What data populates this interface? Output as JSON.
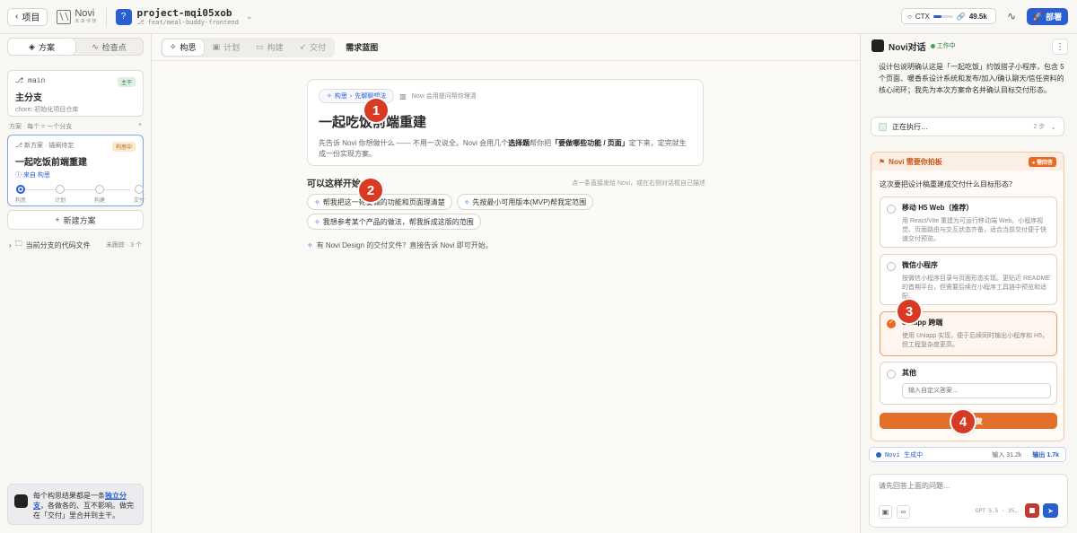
{
  "topbar": {
    "back_label": "项目",
    "logo_text": "Novi",
    "logo_sub": "未 来 伴 随",
    "project_name": "project-mqi05xob",
    "project_branch": "feat/meal-buddy-frontend",
    "ctx_label": "CTX",
    "ctx_fraction": 0.4,
    "token_count": "49.5k",
    "deploy_label": "部署"
  },
  "sidebar": {
    "tabs": [
      {
        "label": "方案",
        "active": true
      },
      {
        "label": "检查点",
        "active": false
      }
    ],
    "main_branch": {
      "branch": "main",
      "tag": "主干",
      "title": "主分支",
      "desc": "chore: 初始化项目仓库"
    },
    "plans_header": "方案 · 每个 = 一个分支",
    "plans_add": "+",
    "plan": {
      "top": "新方案 · 锚阐待定",
      "tag": "构思中",
      "title": "一起吃饭前端重建",
      "from": "来自 构思",
      "steps": [
        "构思",
        "计划",
        "构建",
        "交付"
      ],
      "active_step": 0
    },
    "new_plan_label": "新建方案",
    "code_files_label": "当前分支的代码文件",
    "code_files_meta": "未跟踪 · 3 个",
    "hint": {
      "before": "每个构思结果都是一条",
      "link": "独立分支",
      "after": "，各做各的、互不影响。做完在「交付」里合并到主干。"
    }
  },
  "main": {
    "tabs": [
      {
        "label": "构思",
        "active": true
      },
      {
        "label": "计划",
        "active": false
      },
      {
        "label": "构建",
        "active": false
      },
      {
        "label": "交付",
        "active": false
      }
    ],
    "title": "需求蓝图",
    "intro": {
      "crumb_a": "构思",
      "crumb_b": "先聊聊想法",
      "crumb_hint": "Novi 会用提问帮你理清",
      "title": "一起吃饭前端重建",
      "desc_1": "先告诉 Novi 你想做什么 —— 不用一次说全。Novi 会用几个",
      "desc_bold_1": "选择题",
      "desc_2": "帮你把",
      "desc_bold_2": "「要做哪些功能 / 页面」",
      "desc_3": "定下来，定完就生成一份实现方案。"
    },
    "start_title": "可以这样开始",
    "start_hint": "点一条直接发给 Novi，或在右侧对话框自己描述",
    "chips": [
      "帮我把这一轮要做的功能和页面理清楚",
      "先按最小可用版本(MVP)帮我定范围",
      "我想参考某个产品的做法，帮我拆成这版的范围"
    ],
    "design_note": "有 Novi Design 的交付文件？直接告诉 Novi 即可开始。"
  },
  "chat": {
    "title": "Novi对话",
    "status": "工作中",
    "message": "设计包说明确认这是「一起吃饭」约饭搭子小程序，包含 5 个页面、暖香系设计系统和发布/加入/确认聊天/信任资料的核心闭环；我先为本次方案命名并确认目标交付形态。",
    "running_label": "正在执行…",
    "running_steps": "2 步",
    "ask": {
      "header": "Novi 需要你拍板",
      "badge": "● 需回答",
      "question": "这次要把设计稿重建成交付什么目标形态？",
      "options": [
        {
          "title": "移动 H5 Web（推荐）",
          "desc": "用 React/Vite 重建为可运行移动端 Web。小程序视觉、页面路由与交互状态齐备，适合当前交付便于快速交付预览。",
          "selected": false
        },
        {
          "title": "微信小程序",
          "desc": "按微信小程序目录与页面形态实现。更贴近 README 的首期平台，但需要后续在小程序工具链中预览和适配。",
          "selected": false
        },
        {
          "title": "Uniapp 跨端",
          "desc": "使用 Uniapp 实现，便于后续同时输出小程序和 H5，但工程复杂度更高。",
          "selected": true
        },
        {
          "title": "其他",
          "desc": "",
          "selected": false
        }
      ],
      "other_placeholder": "输入自定义答案…",
      "confirm_label": "确认回复"
    },
    "gen": {
      "label": "Novi 生成中",
      "input_label": "输入 31.2k",
      "output_label": "输出 1.7k"
    },
    "composer_placeholder": "请先回答上面的问题…",
    "model_label": "GPT 5.5 · 35⌄"
  },
  "markers": [
    "1",
    "2",
    "3",
    "4"
  ],
  "colors": {
    "accent_blue": "#2a5fd1",
    "accent_orange": "#e2702a",
    "marker_red": "#d83a24"
  }
}
